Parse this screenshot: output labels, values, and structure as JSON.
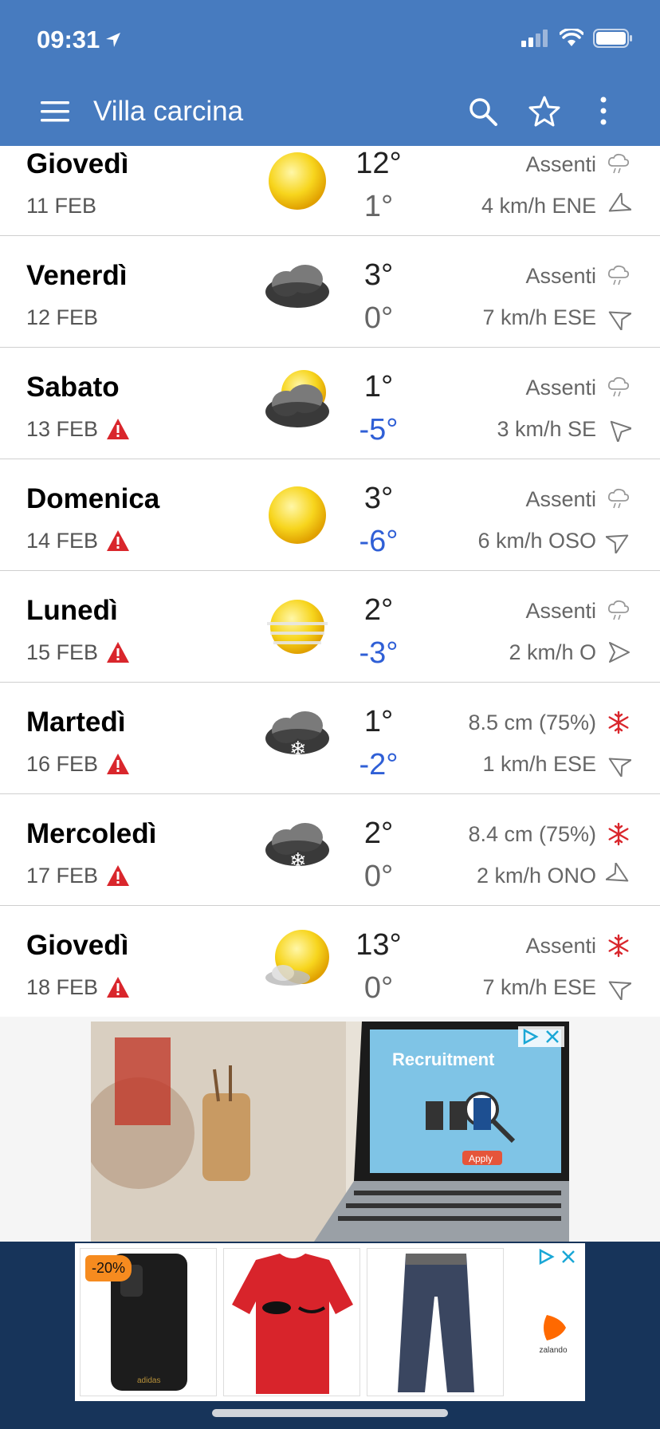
{
  "status_bar": {
    "time": "09:31"
  },
  "toolbar": {
    "title": "Villa carcina"
  },
  "days": [
    {
      "name": "Giovedì",
      "date": "11 FEB",
      "warning": false,
      "weather": "sunny",
      "max": "12°",
      "min": "1°",
      "min_negative": false,
      "precip": "Assenti",
      "precip_icon": "rain-icon",
      "wind": "4 km/h ENE",
      "wind_dir_deg": 240
    },
    {
      "name": "Venerdì",
      "date": "12 FEB",
      "warning": false,
      "weather": "cloudy",
      "max": "3°",
      "min": "0°",
      "min_negative": false,
      "precip": "Assenti",
      "precip_icon": "rain-icon",
      "wind": "7 km/h ESE",
      "wind_dir_deg": 300
    },
    {
      "name": "Sabato",
      "date": "13 FEB",
      "warning": true,
      "weather": "partly-cloudy",
      "max": "1°",
      "min": "-5°",
      "min_negative": true,
      "precip": "Assenti",
      "precip_icon": "rain-icon",
      "wind": "3 km/h SE",
      "wind_dir_deg": 315
    },
    {
      "name": "Domenica",
      "date": "14 FEB",
      "warning": true,
      "weather": "sunny",
      "max": "3°",
      "min": "-6°",
      "min_negative": true,
      "precip": "Assenti",
      "precip_icon": "rain-icon",
      "wind": "6 km/h OSO",
      "wind_dir_deg": 60
    },
    {
      "name": "Lunedì",
      "date": "15 FEB",
      "warning": true,
      "weather": "hazy-sun",
      "max": "2°",
      "min": "-3°",
      "min_negative": true,
      "precip": "Assenti",
      "precip_icon": "rain-icon",
      "wind": "2 km/h O",
      "wind_dir_deg": 90
    },
    {
      "name": "Martedì",
      "date": "16 FEB",
      "warning": true,
      "weather": "snow",
      "max": "1°",
      "min": "-2°",
      "min_negative": true,
      "precip": "8.5 cm (75%)",
      "precip_icon": "snowflake-icon",
      "wind": "1 km/h ESE",
      "wind_dir_deg": 300
    },
    {
      "name": "Mercoledì",
      "date": "17 FEB",
      "warning": true,
      "weather": "snow",
      "max": "2°",
      "min": "0°",
      "min_negative": false,
      "precip": "8.4 cm (75%)",
      "precip_icon": "snowflake-icon",
      "wind": "2 km/h ONO",
      "wind_dir_deg": 120
    },
    {
      "name": "Giovedì",
      "date": "18 FEB",
      "warning": true,
      "weather": "sun-clouds",
      "max": "13°",
      "min": "0°",
      "min_negative": false,
      "precip": "Assenti",
      "precip_icon": "snowflake-icon",
      "wind": "7 km/h ESE",
      "wind_dir_deg": 300
    }
  ],
  "ads": {
    "banner_text": "Recruitment",
    "banner_button": "Apply",
    "discount": "-20%",
    "brand_small": "adidas",
    "advertiser": "zalando"
  },
  "colors": {
    "header": "#477bbf",
    "negative_temp": "#2f5fd6",
    "warning": "#d9262c",
    "snow": "#d9262c",
    "bottom_bar": "#17345a"
  }
}
